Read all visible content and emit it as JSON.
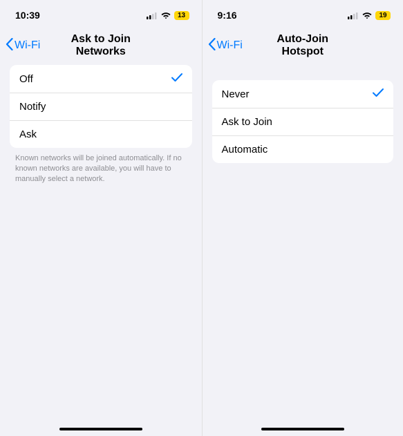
{
  "screens": [
    {
      "status": {
        "time": "10:39",
        "battery": "13"
      },
      "nav": {
        "back": "Wi-Fi",
        "title": "Ask to Join Networks"
      },
      "options": [
        {
          "label": "Off",
          "selected": true
        },
        {
          "label": "Notify",
          "selected": false
        },
        {
          "label": "Ask",
          "selected": false
        }
      ],
      "footer": "Known networks will be joined automatically. If no known networks are available, you will have to manually select a network."
    },
    {
      "status": {
        "time": "9:16",
        "battery": "19"
      },
      "nav": {
        "back": "Wi-Fi",
        "title": "Auto-Join Hotspot"
      },
      "options": [
        {
          "label": "Never",
          "selected": true
        },
        {
          "label": "Ask to Join",
          "selected": false
        },
        {
          "label": "Automatic",
          "selected": false
        }
      ],
      "footer": ""
    }
  ]
}
